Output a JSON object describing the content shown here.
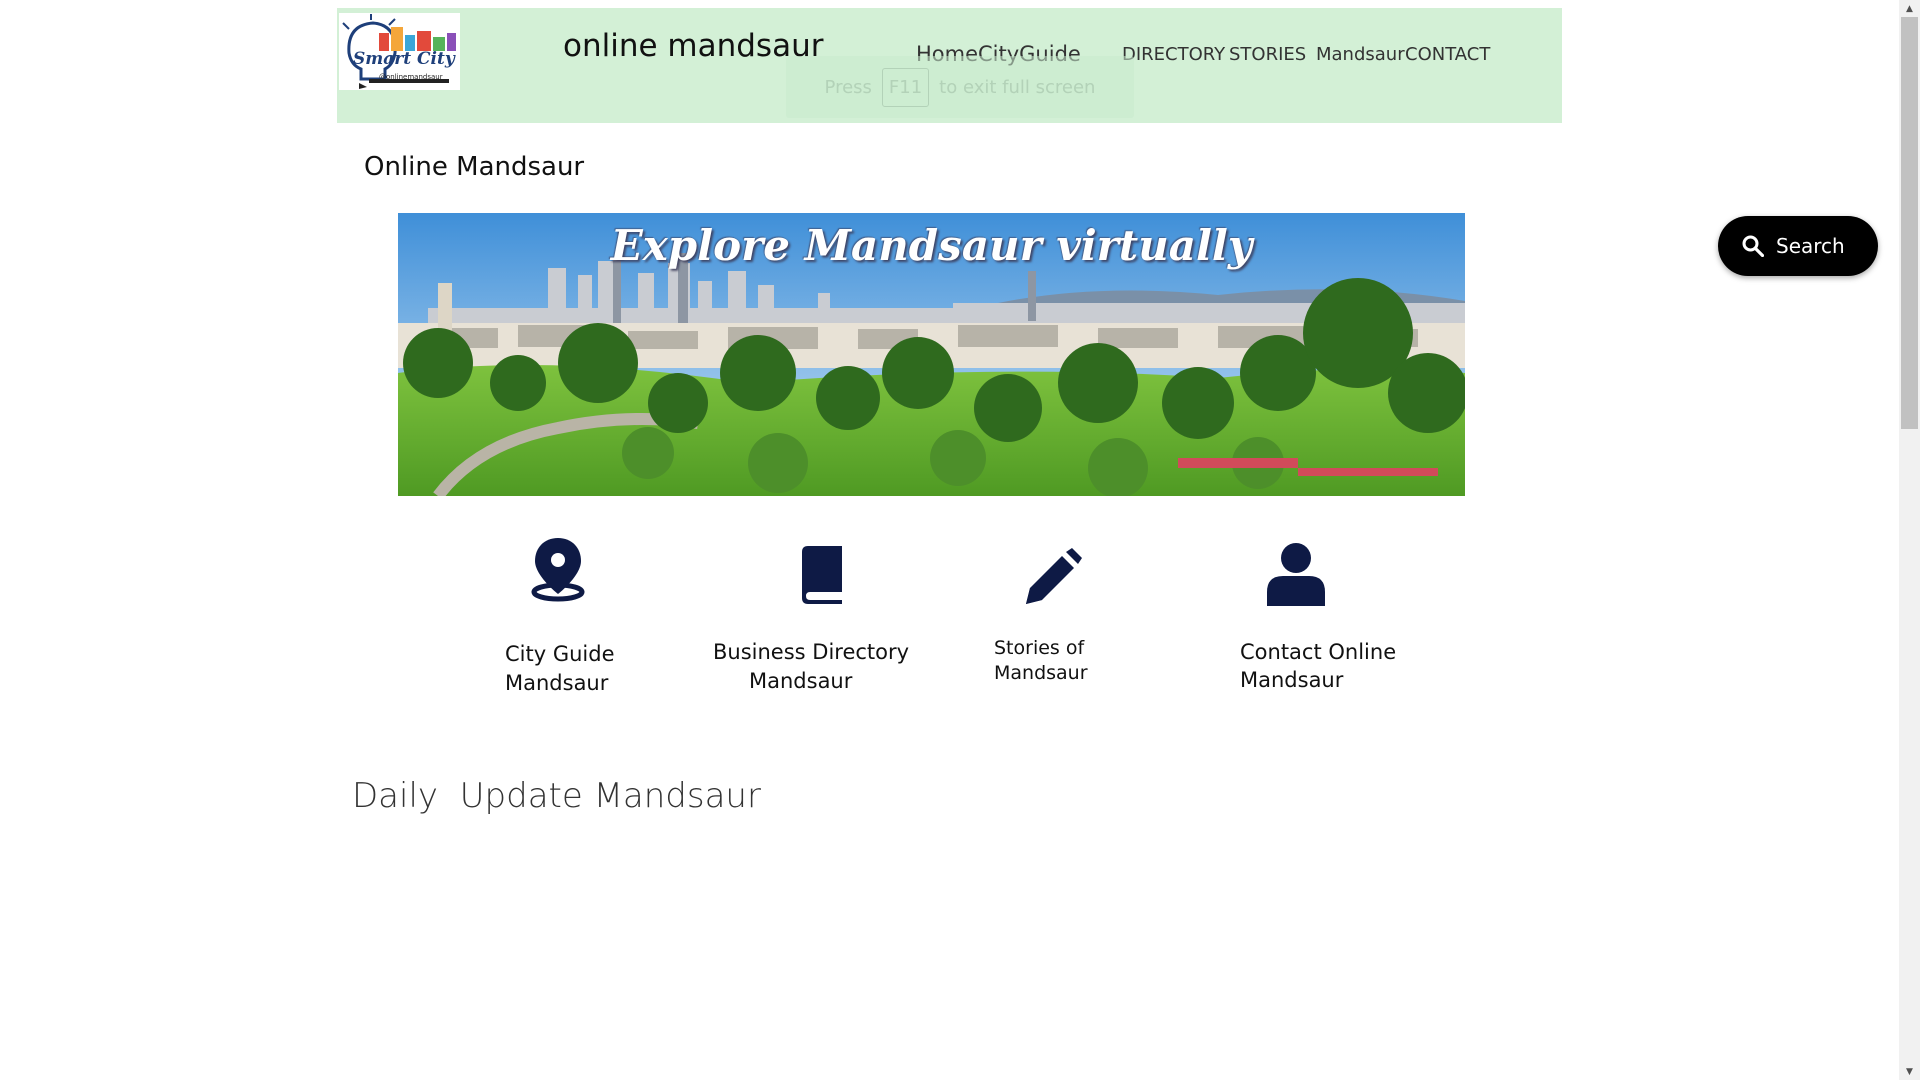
{
  "header": {
    "logo": {
      "text": "Smart City",
      "handle": "@onlinemandsaur"
    },
    "site_title": "online mandsaur",
    "nav": [
      "Home",
      "CityGuide",
      "DIRECTORY",
      "STORIES",
      "Mandsaur",
      "CONTACT"
    ]
  },
  "fullscreen_toast": {
    "press": "Press",
    "key": "F11",
    "rest": "to exit full screen"
  },
  "page_heading": "Online Mandsaur",
  "banner": {
    "caption": "Explore Mandsaur virtually"
  },
  "features": [
    {
      "icon": "location-pin-icon",
      "line1": "City Guide",
      "line2": "Mandsaur"
    },
    {
      "icon": "book-icon",
      "line1": "Business Directory",
      "line2": "Mandsaur"
    },
    {
      "icon": "pencil-icon",
      "line1": "Stories of",
      "line2": "Mandsaur"
    },
    {
      "icon": "person-icon",
      "line1": "Contact Online",
      "line2": "Mandsaur"
    }
  ],
  "search": {
    "label": "Search",
    "icon": "search-icon"
  },
  "daily_heading": "Daily  Update Mandsaur",
  "colors": {
    "header_bg": "#d3f0d6",
    "icon_navy": "#0e1a45",
    "search_bg": "#000000"
  }
}
